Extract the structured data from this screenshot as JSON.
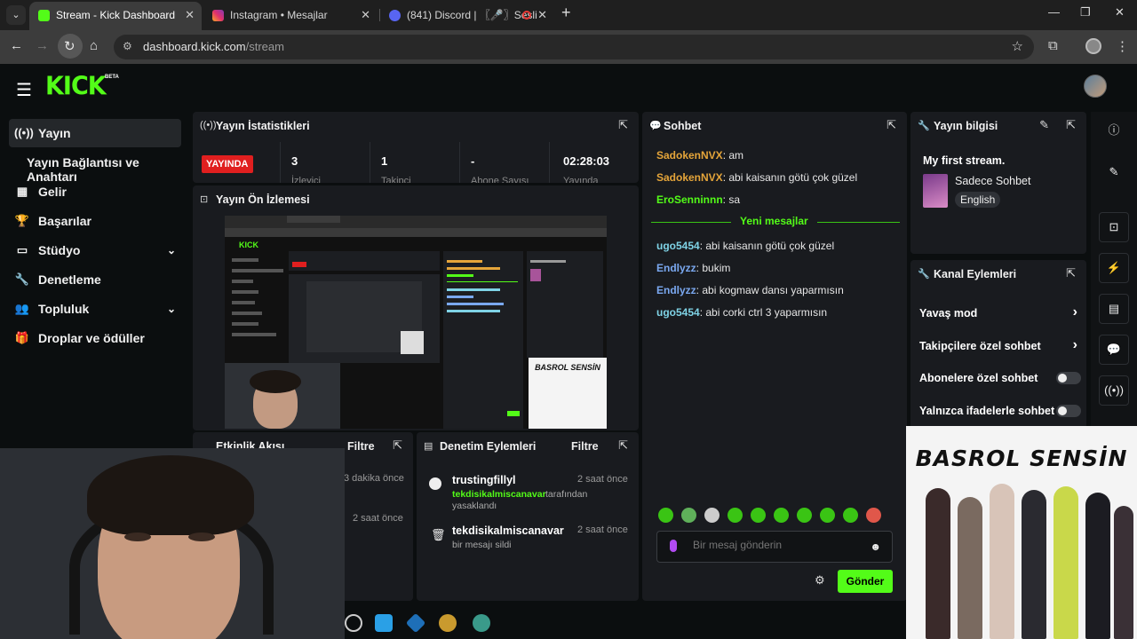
{
  "browser": {
    "tabs": [
      {
        "title": "Stream - Kick Dashboard",
        "active": true
      },
      {
        "title": "Instagram • Mesajlar",
        "active": false
      },
      {
        "title": "(841) Discord | 〖🎤〗Sesli",
        "active": false
      }
    ],
    "url_domain": "dashboard.kick.com",
    "url_path": "/stream"
  },
  "header": {
    "logo": "KICK",
    "badge": "BETA"
  },
  "sidebar": {
    "items": [
      {
        "label": "Yayın",
        "icon": "broadcast-icon"
      },
      {
        "label": "Yayın Bağlantısı ve Anahtarı",
        "icon": ""
      },
      {
        "label": "Gelir",
        "icon": "bar-chart-icon"
      },
      {
        "label": "Başarılar",
        "icon": "trophy-icon"
      },
      {
        "label": "Stüdyo",
        "icon": "studio-icon"
      },
      {
        "label": "Denetleme",
        "icon": "wrench-icon"
      },
      {
        "label": "Topluluk",
        "icon": "community-icon"
      },
      {
        "label": "Droplar ve ödüller",
        "icon": "gift-icon"
      }
    ]
  },
  "stats": {
    "title": "Yayın İstatistikleri",
    "live": "YAYINDA",
    "values": [
      {
        "value": "3",
        "label": "İzleyici"
      },
      {
        "value": "1",
        "label": "Takipçi"
      },
      {
        "value": "-",
        "label": "Abone Sayısı"
      },
      {
        "value": "02:28:03",
        "label": "Yayında"
      }
    ]
  },
  "preview": {
    "title": "Yayın Ön İzlemesi"
  },
  "activity": {
    "title": "Etkinlik Akışı",
    "filter": "Filtre",
    "times": [
      "3 dakika önce",
      "2 saat önce"
    ]
  },
  "moderation": {
    "title": "Denetim Eylemleri",
    "filter": "Filtre",
    "entries": [
      {
        "user": "trustingfillyl",
        "time": "2 saat önce",
        "by": "tekdisikalmiscanavar",
        "desc": "tarafından yasaklandı"
      },
      {
        "user": "tekdisikalmiscanavar",
        "time": "2 saat önce",
        "by": "",
        "desc": "bir mesajı sildi"
      }
    ]
  },
  "chat": {
    "title": "Sohbet",
    "messages_before": [
      {
        "user": "SadokenNVX",
        "color": "#e5a53a",
        "text": "am"
      },
      {
        "user": "SadokenNVX",
        "color": "#e5a53a",
        "text": "abi kaisanın götü çok güzel"
      },
      {
        "user": "EroSenninnn",
        "color": "#53fc18",
        "text": "sa"
      }
    ],
    "new_label": "Yeni mesajlar",
    "messages_after": [
      {
        "user": "ugo5454",
        "color": "#7fd3e6",
        "text": "abi kaisanın götü çok güzel"
      },
      {
        "user": "Endlyzz",
        "color": "#7aa8f0",
        "text": "bukim"
      },
      {
        "user": "Endlyzz",
        "color": "#7aa8f0",
        "text": "abi kogmaw dansı yaparmısın"
      },
      {
        "user": "ugo5454",
        "color": "#7fd3e6",
        "text": "abi corki ctrl 3 yaparmısın"
      }
    ],
    "placeholder": "Bir mesaj gönderin",
    "send": "Gönder"
  },
  "info": {
    "title": "Yayın bilgisi",
    "stream_title": "My first stream.",
    "category": "Sadece Sohbet",
    "language": "English"
  },
  "actions": {
    "title": "Kanal Eylemleri",
    "rows": [
      {
        "label": "Yavaş mod",
        "kind": "arrow"
      },
      {
        "label": "Takipçilere özel sohbet",
        "kind": "arrow"
      },
      {
        "label": "Abonelere özel sohbet",
        "kind": "toggle"
      },
      {
        "label": "Yalnızca ifadelerle sohbet",
        "kind": "toggle"
      }
    ]
  },
  "album": {
    "title": "BASROL SENSİN"
  },
  "colors": {
    "brand": "#53fc18",
    "live": "#e01f1f",
    "panel": "#191b1f",
    "bg": "#0b0e0f"
  }
}
